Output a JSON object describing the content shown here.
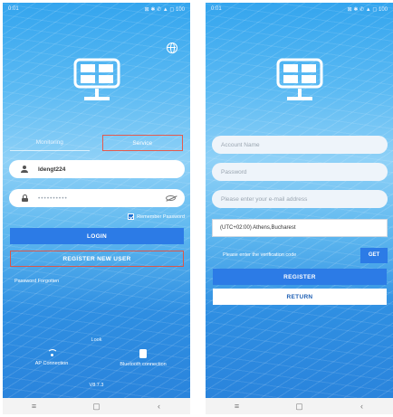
{
  "left_screen": {
    "status_time": "0:01",
    "status_icons": "⊠ ✱ ✆ ▲ ◻ 100",
    "username_value": "ldengt224",
    "password_mask": "••••••••••",
    "tabs": [
      "Monitoring",
      "Service"
    ],
    "remember_label": "Remember Password",
    "login_label": "LOGIN",
    "register_label": "REGISTER NEW USER",
    "forgot_label": "Password Forgotten",
    "look_label": "Look",
    "ap_label": "AP Connection",
    "bt_label": "Bluetooth connection",
    "version": "V8.7.3"
  },
  "right_screen": {
    "status_time": "0:01",
    "status_icons": "⊠ ✱ ✆ ▲ ◻ 100",
    "account_placeholder": "Account Name",
    "password_placeholder": "Password",
    "email_placeholder": "Please enter your e-mail address",
    "timezone_value": "(UTC+02:00) Athens,Bucharest",
    "verification_text": "Please enter the verification code",
    "get_label": "GET",
    "register_label": "REGISTER",
    "return_label": "RETURN"
  },
  "nav": {
    "home": "≡",
    "recent": "▢",
    "back": "‹"
  },
  "colors": {
    "sky_blue": "#34a5ee",
    "button_blue": "#2c7be6",
    "outline_red": "#e45a4d"
  },
  "icons": [
    "solar-panel-logo-icon",
    "globe-icon",
    "user-icon",
    "lock-icon",
    "eye-off-icon",
    "checkbox-icon",
    "wifi-icon",
    "bluetooth-device-icon"
  ]
}
